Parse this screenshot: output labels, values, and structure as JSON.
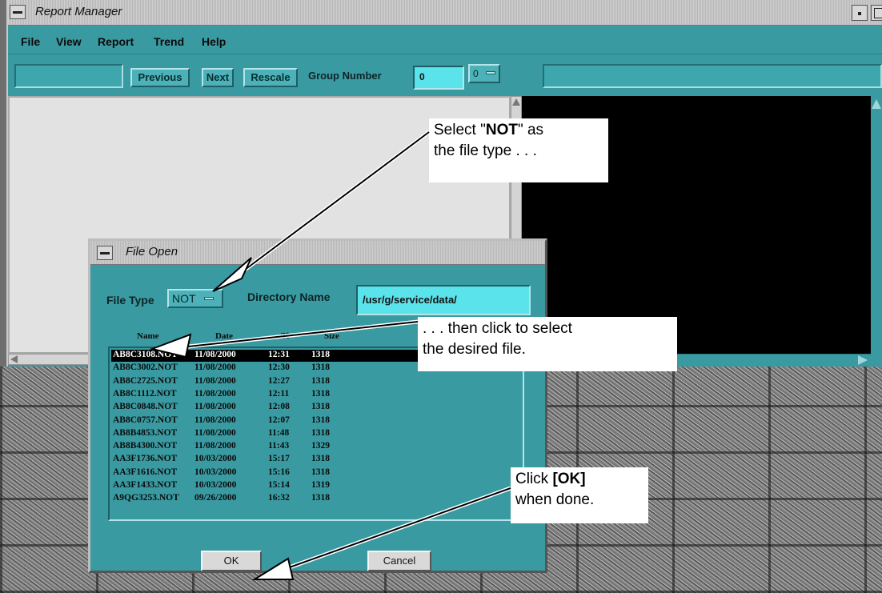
{
  "window": {
    "title": "Report Manager",
    "menu": [
      "File",
      "View",
      "Report",
      "Trend",
      "Help"
    ]
  },
  "toolbar": {
    "previous_label": "Previous",
    "next_label": "Next",
    "rescale_label": "Rescale",
    "group_number_label": "Group Number",
    "group_number_value": "0",
    "group_select_value": "0"
  },
  "dialog": {
    "title": "File Open",
    "file_type_label": "File Type",
    "file_type_value": "NOT",
    "directory_label": "Directory Name",
    "directory_value": "/usr/g/service/data/",
    "columns": [
      "Name",
      "Date",
      "Ti",
      "Size"
    ],
    "files": [
      {
        "name": "AB8C3108.NOT",
        "date": "11/08/2000",
        "time": "12:31",
        "size": "1318",
        "selected": true
      },
      {
        "name": "AB8C3002.NOT",
        "date": "11/08/2000",
        "time": "12:30",
        "size": "1318"
      },
      {
        "name": "AB8C2725.NOT",
        "date": "11/08/2000",
        "time": "12:27",
        "size": "1318"
      },
      {
        "name": "AB8C1112.NOT",
        "date": "11/08/2000",
        "time": "12:11",
        "size": "1318"
      },
      {
        "name": "AB8C0848.NOT",
        "date": "11/08/2000",
        "time": "12:08",
        "size": "1318"
      },
      {
        "name": "AB8C0757.NOT",
        "date": "11/08/2000",
        "time": "12:07",
        "size": "1318"
      },
      {
        "name": "AB8B4853.NOT",
        "date": "11/08/2000",
        "time": "11:48",
        "size": "1318"
      },
      {
        "name": "AB8B4300.NOT",
        "date": "11/08/2000",
        "time": "11:43",
        "size": "1329"
      },
      {
        "name": "AA3F1736.NOT",
        "date": "10/03/2000",
        "time": "15:17",
        "size": "1318"
      },
      {
        "name": "AA3F1616.NOT",
        "date": "10/03/2000",
        "time": "15:16",
        "size": "1318"
      },
      {
        "name": "AA3F1433.NOT",
        "date": "10/03/2000",
        "time": "15:14",
        "size": "1319"
      },
      {
        "name": "A9QG3253.NOT",
        "date": "09/26/2000",
        "time": "16:32",
        "size": "1318"
      }
    ],
    "ok_label": "OK",
    "cancel_label": "Cancel"
  },
  "callouts": {
    "c1_pre": "Select \"",
    "c1_bold": "NOT",
    "c1_post": "\" as",
    "c1_line2": "the file type . . .",
    "c2_line1": ". . .  then click to select",
    "c2_line2": "the desired file.",
    "c3_pre": "Click ",
    "c3_bold": "[OK]",
    "c3_line2": "when done."
  }
}
